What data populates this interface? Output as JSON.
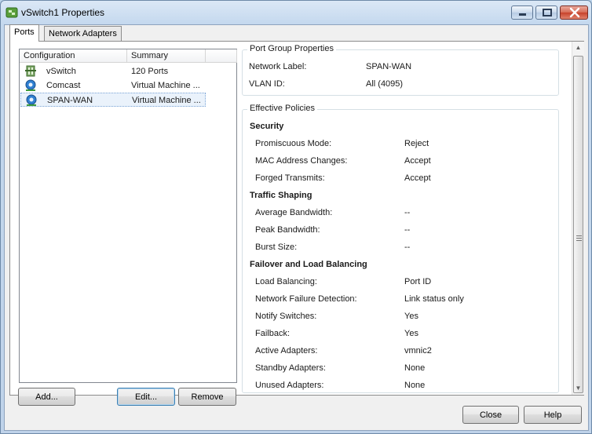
{
  "window": {
    "title": "vSwitch1 Properties"
  },
  "tabs": [
    {
      "label": "Ports",
      "active": true
    },
    {
      "label": "Network Adapters",
      "active": false
    }
  ],
  "list": {
    "columns": [
      "Configuration",
      "Summary"
    ],
    "rows": [
      {
        "icon": "vswitch-icon",
        "name": "vSwitch",
        "summary": "120 Ports",
        "selected": false
      },
      {
        "icon": "port-group-icon",
        "name": "Comcast",
        "summary": "Virtual Machine ...",
        "selected": false
      },
      {
        "icon": "port-group-icon",
        "name": "SPAN-WAN",
        "summary": "Virtual Machine ...",
        "selected": true
      }
    ]
  },
  "list_buttons": {
    "add": "Add...",
    "edit": "Edit...",
    "remove": "Remove"
  },
  "port_group_properties": {
    "legend": "Port Group Properties",
    "items": [
      {
        "label": "Network Label:",
        "value": "SPAN-WAN"
      },
      {
        "label": "VLAN ID:",
        "value": "All (4095)"
      }
    ]
  },
  "effective_policies": {
    "legend": "Effective Policies",
    "sections": [
      {
        "title": "Security",
        "items": [
          {
            "label": "Promiscuous Mode:",
            "value": "Reject"
          },
          {
            "label": "MAC Address Changes:",
            "value": "Accept"
          },
          {
            "label": "Forged Transmits:",
            "value": "Accept"
          }
        ]
      },
      {
        "title": "Traffic Shaping",
        "items": [
          {
            "label": "Average Bandwidth:",
            "value": "--"
          },
          {
            "label": "Peak Bandwidth:",
            "value": "--"
          },
          {
            "label": "Burst Size:",
            "value": "--"
          }
        ]
      },
      {
        "title": "Failover and Load Balancing",
        "items": [
          {
            "label": "Load Balancing:",
            "value": "Port ID"
          },
          {
            "label": "Network Failure Detection:",
            "value": "Link status only"
          },
          {
            "label": "Notify Switches:",
            "value": "Yes"
          },
          {
            "label": "Failback:",
            "value": "Yes"
          },
          {
            "label": "Active Adapters:",
            "value": "vmnic2"
          },
          {
            "label": "Standby Adapters:",
            "value": "None"
          },
          {
            "label": "Unused Adapters:",
            "value": "None"
          }
        ]
      }
    ]
  },
  "footer_buttons": {
    "close": "Close",
    "help": "Help"
  }
}
